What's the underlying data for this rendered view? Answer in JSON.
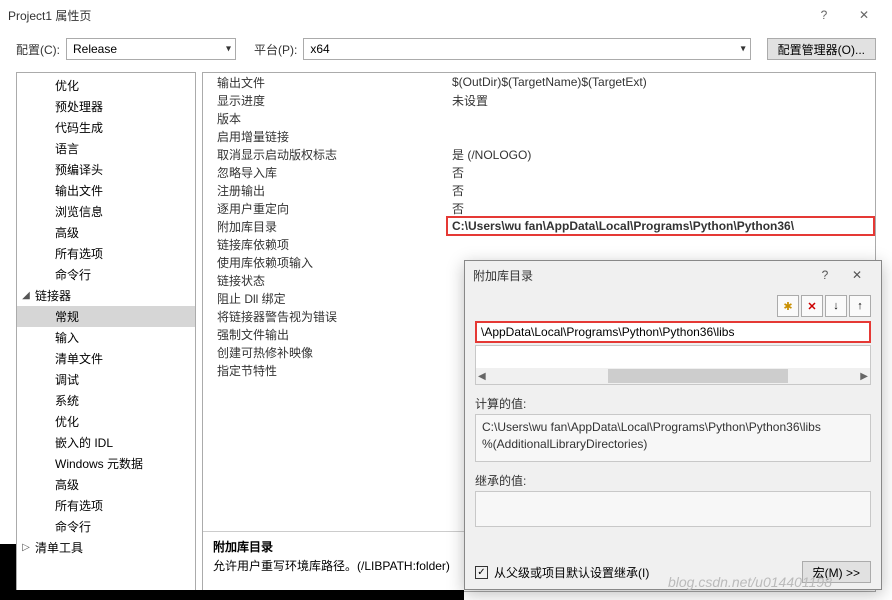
{
  "window": {
    "title": "Project1 属性页",
    "help": "?",
    "close": "✕"
  },
  "toprow": {
    "config_label": "配置(C):",
    "config_value": "Release",
    "platform_label": "平台(P):",
    "platform_value": "x64",
    "manager_btn": "配置管理器(O)..."
  },
  "tree": [
    {
      "label": "优化",
      "depth": 1
    },
    {
      "label": "预处理器",
      "depth": 1
    },
    {
      "label": "代码生成",
      "depth": 1
    },
    {
      "label": "语言",
      "depth": 1
    },
    {
      "label": "预编译头",
      "depth": 1
    },
    {
      "label": "输出文件",
      "depth": 1
    },
    {
      "label": "浏览信息",
      "depth": 1
    },
    {
      "label": "高级",
      "depth": 1
    },
    {
      "label": "所有选项",
      "depth": 1
    },
    {
      "label": "命令行",
      "depth": 1
    },
    {
      "label": "链接器",
      "depth": 0,
      "exp": "◢"
    },
    {
      "label": "常规",
      "depth": 1,
      "sel": true
    },
    {
      "label": "输入",
      "depth": 1
    },
    {
      "label": "清单文件",
      "depth": 1
    },
    {
      "label": "调试",
      "depth": 1
    },
    {
      "label": "系统",
      "depth": 1
    },
    {
      "label": "优化",
      "depth": 1
    },
    {
      "label": "嵌入的 IDL",
      "depth": 1
    },
    {
      "label": "Windows 元数据",
      "depth": 1
    },
    {
      "label": "高级",
      "depth": 1
    },
    {
      "label": "所有选项",
      "depth": 1
    },
    {
      "label": "命令行",
      "depth": 1
    },
    {
      "label": "清单工具",
      "depth": 0,
      "exp": "▷"
    }
  ],
  "props": [
    {
      "k": "输出文件",
      "v": "$(OutDir)$(TargetName)$(TargetExt)"
    },
    {
      "k": "显示进度",
      "v": "未设置"
    },
    {
      "k": "版本",
      "v": ""
    },
    {
      "k": "启用增量链接",
      "v": ""
    },
    {
      "k": "取消显示启动版权标志",
      "v": "是 (/NOLOGO)"
    },
    {
      "k": "忽略导入库",
      "v": "否"
    },
    {
      "k": "注册输出",
      "v": "否"
    },
    {
      "k": "逐用户重定向",
      "v": "否"
    },
    {
      "k": "附加库目录",
      "v": "C:\\Users\\wu fan\\AppData\\Local\\Programs\\Python\\Python36\\",
      "hl": true
    },
    {
      "k": "链接库依赖项",
      "v": ""
    },
    {
      "k": "使用库依赖项输入",
      "v": ""
    },
    {
      "k": "链接状态",
      "v": ""
    },
    {
      "k": "阻止 Dll 绑定",
      "v": ""
    },
    {
      "k": "将链接器警告视为错误",
      "v": ""
    },
    {
      "k": "强制文件输出",
      "v": ""
    },
    {
      "k": "创建可热修补映像",
      "v": ""
    },
    {
      "k": "指定节特性",
      "v": ""
    }
  ],
  "desc": {
    "title": "附加库目录",
    "text": "允许用户重写环境库路径。(/LIBPATH:folder)"
  },
  "popup": {
    "title": "附加库目录",
    "help": "?",
    "close": "✕",
    "toolbar": {
      "new": "✱",
      "del": "✕",
      "down": "↓",
      "up": "↑"
    },
    "path": "\\AppData\\Local\\Programs\\Python\\Python36\\libs",
    "computed_label": "计算的值:",
    "computed_value": "C:\\Users\\wu fan\\AppData\\Local\\Programs\\Python\\Python36\\libs\n%(AdditionalLibraryDirectories)",
    "inherited_label": "继承的值:",
    "inherit_checkbox": "从父级或项目默认设置继承(I)",
    "macro_btn": "宏(M) >>"
  },
  "watermark": "blog.csdn.net/u014401198"
}
